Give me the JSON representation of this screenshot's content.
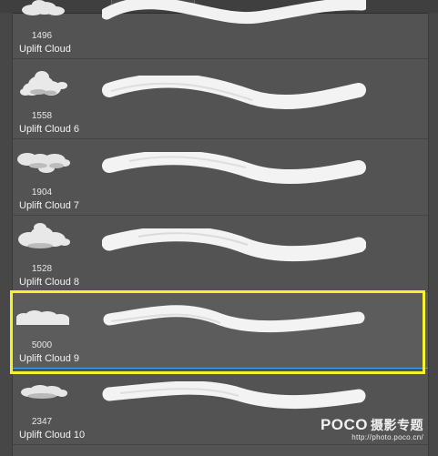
{
  "panel": {
    "brushes": [
      {
        "size": "1496",
        "name": "Uplift Cloud"
      },
      {
        "size": "1558",
        "name": "Uplift Cloud 6"
      },
      {
        "size": "1904",
        "name": "Uplift Cloud 7"
      },
      {
        "size": "1528",
        "name": "Uplift Cloud 8"
      },
      {
        "size": "5000",
        "name": "Uplift Cloud 9",
        "selected": true
      },
      {
        "size": "2347",
        "name": "Uplift Cloud 10"
      }
    ]
  },
  "watermark": {
    "logo": "POCO",
    "logo_cn": "摄影专题",
    "url": "http://photo.poco.cn/"
  },
  "colors": {
    "panel_bg": "#535353",
    "selection_outline": "#f6f22a",
    "selection_underline": "#47a3ff"
  },
  "icons": {
    "thumbnail": "cloud-brush-thumbnail-icon",
    "stroke": "brush-stroke-preview-icon"
  }
}
